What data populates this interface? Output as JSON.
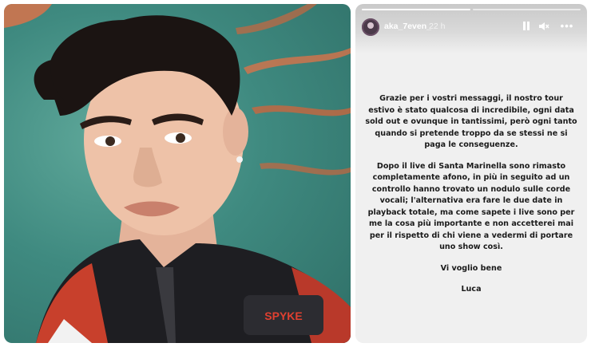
{
  "story": {
    "username": "aka_7even_",
    "time": "22 h",
    "progress": [
      1.0,
      0.0
    ],
    "icons": {
      "pause": "pause-icon",
      "mute": "speaker-muted-icon",
      "more": "more-dots-icon"
    },
    "paragraphs": [
      "Grazie per i vostri messaggi, il nostro tour estivo è stato qualcosa di incredibile, ogni data sold out e ovunque in tantissimi, però ogni tanto quando si pretende troppo da se stessi ne si paga le conseguenze.",
      "Dopo il live di Santa Marinella sono rimasto completamente afono, in più in seguito ad un controllo hanno trovato un nodulo sulle corde vocali; l'alternativa era fare le due date in playback totale, ma come sapete i live sono per me la cosa più importante e non accetterei mai per il rispetto di chi viene a vedermi di portare uno show così.",
      "Vi voglio bene",
      "Luca"
    ]
  },
  "photo": {
    "jacket_brand": "SPYKE"
  }
}
